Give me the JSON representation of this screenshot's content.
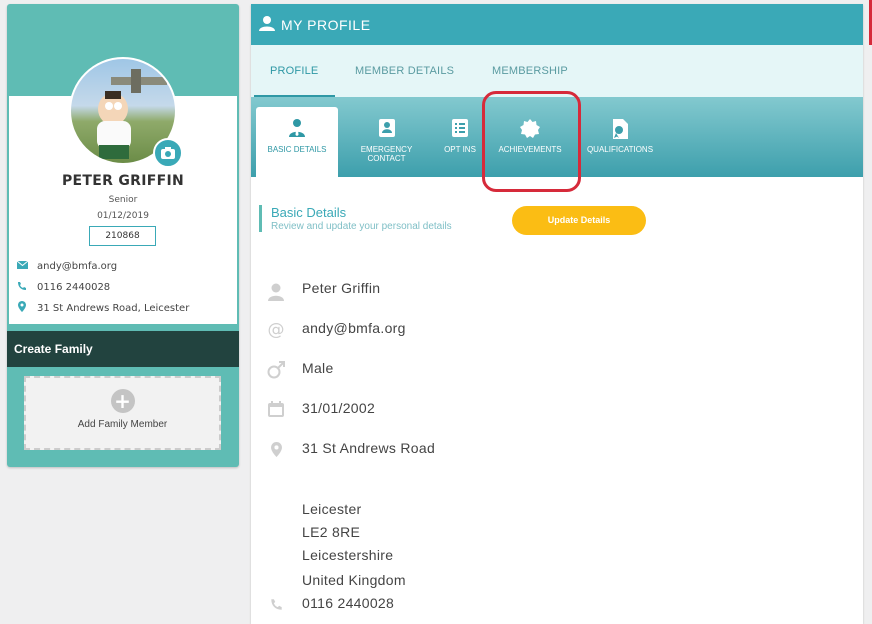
{
  "profile": {
    "name": "PETER GRIFFIN",
    "level": "Senior",
    "date": "01/12/2019",
    "member_id": "210868",
    "email": "andy@bmfa.org",
    "phone": "0116 2440028",
    "address": "31 St Andrews Road, Leicester"
  },
  "family": {
    "create_label": "Create Family",
    "add_label": "Add Family Member"
  },
  "header": {
    "title": "MY PROFILE"
  },
  "top_tabs": [
    {
      "label": "PROFILE",
      "active": true
    },
    {
      "label": "MEMBER DETAILS"
    },
    {
      "label": "MEMBERSHIP"
    }
  ],
  "sub_tabs": [
    {
      "label": "BASIC DETAILS",
      "active": true
    },
    {
      "label": "EMERGENCY CONTACT"
    },
    {
      "label": "OPT INS"
    },
    {
      "label": "ACHIEVEMENTS"
    },
    {
      "label": "QUALIFICATIONS"
    }
  ],
  "section": {
    "title": "Basic Details",
    "subtitle": "Review and update your personal details",
    "update_button": "Update Details"
  },
  "details": {
    "full_name": "Peter Griffin",
    "email": "andy@bmfa.org",
    "gender": "Male",
    "dob": "31/01/2002",
    "address_line1": "31 St Andrews Road",
    "city": "Leicester",
    "postcode": "LE2 8RE",
    "county": "Leicestershire",
    "country": "United Kingdom",
    "phone": "0116 2440028"
  },
  "colors": {
    "accent": "#3aa9b7",
    "sidebar": "#5fbcb4",
    "dark": "#22433f",
    "button": "#fbbd14",
    "highlight": "#d62a3a"
  }
}
